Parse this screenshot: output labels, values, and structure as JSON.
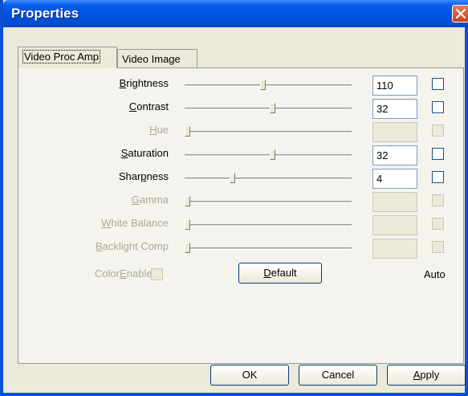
{
  "window": {
    "title": "Properties"
  },
  "tabs": [
    {
      "label": "Video Proc Amp",
      "active": true
    },
    {
      "label": "Video Image",
      "active": false
    }
  ],
  "controls": [
    {
      "label_pre": "",
      "label_u": "B",
      "label_post": "rightness",
      "value": "110",
      "slider_fraction": 0.45,
      "enabled": true,
      "auto": false
    },
    {
      "label_pre": "",
      "label_u": "C",
      "label_post": "ontrast",
      "value": "32",
      "slider_fraction": 0.51,
      "enabled": true,
      "auto": false
    },
    {
      "label_pre": "",
      "label_u": "H",
      "label_post": "ue",
      "value": "",
      "slider_fraction": 0.0,
      "enabled": false,
      "auto": false
    },
    {
      "label_pre": "",
      "label_u": "S",
      "label_post": "aturation",
      "value": "32",
      "slider_fraction": 0.51,
      "enabled": true,
      "auto": false
    },
    {
      "label_pre": "Shar",
      "label_u": "p",
      "label_post": "ness",
      "value": "4",
      "slider_fraction": 0.27,
      "enabled": true,
      "auto": false
    },
    {
      "label_pre": "",
      "label_u": "G",
      "label_post": "amma",
      "value": "",
      "slider_fraction": 0.0,
      "enabled": false,
      "auto": false
    },
    {
      "label_pre": "",
      "label_u": "W",
      "label_post": "hite Balance",
      "value": "",
      "slider_fraction": 0.0,
      "enabled": false,
      "auto": false
    },
    {
      "label_pre": "",
      "label_u": "B",
      "label_post": "acklight Comp",
      "value": "",
      "slider_fraction": 0.0,
      "enabled": false,
      "auto": false
    }
  ],
  "colorenable": {
    "pre": "Color",
    "u": "E",
    "post": "nable",
    "checked": false
  },
  "default_button": {
    "u": "D",
    "post": "efault"
  },
  "auto_label": "Auto",
  "footer": {
    "ok": "OK",
    "cancel": "Cancel",
    "apply_u": "A",
    "apply_post": "pply"
  }
}
